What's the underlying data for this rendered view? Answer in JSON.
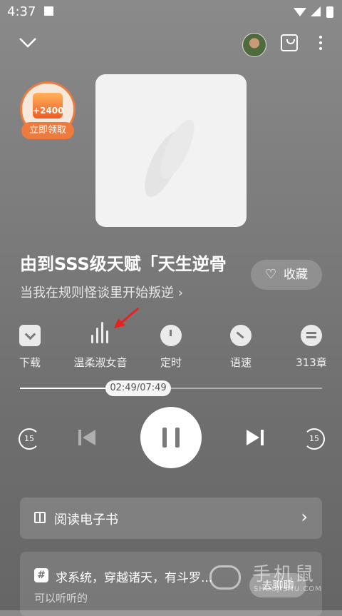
{
  "status": {
    "time": "4:37"
  },
  "promo": {
    "amount": "+2400",
    "button": "立即领取"
  },
  "book": {
    "title": "由到SSS级天赋「天生逆骨",
    "subtitle": "当我在规则怪谈里开始叛逆",
    "fav_label": "收藏"
  },
  "tools": [
    {
      "label": "下载",
      "icon": "download-icon"
    },
    {
      "label": "温柔淑女音",
      "icon": "voice-wave-icon"
    },
    {
      "label": "定时",
      "icon": "timer-icon"
    },
    {
      "label": "语速",
      "icon": "speed-icon"
    },
    {
      "label": "313章",
      "icon": "chapter-list-icon"
    }
  ],
  "player": {
    "time_text": "02:49/07:49",
    "progress": 0.36,
    "skip_back": "15",
    "skip_forward": "15"
  },
  "ebook": {
    "label": "阅读电子书"
  },
  "recommend": {
    "title": "求系统，穿越诸天，有斗罗...",
    "subtitle": "可以听听的",
    "chat_label": "去聊聊"
  },
  "watermark": {
    "cn": "手机鼠",
    "en": "SHOUJISHU.COM"
  },
  "colors": {
    "accent": "#ef7a3d",
    "annotation_arrow": "#e8201e"
  }
}
